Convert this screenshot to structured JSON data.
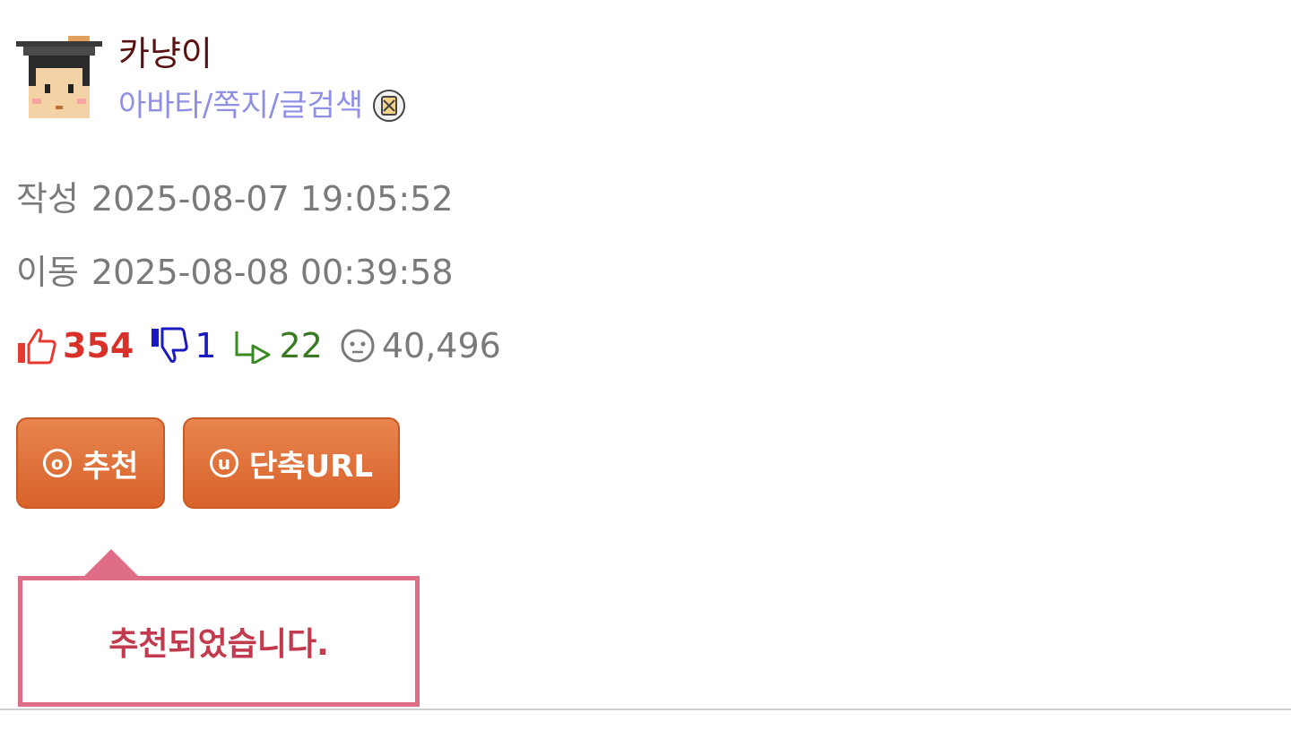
{
  "author": {
    "nickname": "카냥이",
    "links_label": "아바타/쪽지/글검색",
    "avatar_icon": "graduate-avatar-icon",
    "note_icon": "memo-icon"
  },
  "meta": {
    "written_label": "작성",
    "written_time": "2025-08-07 19:05:52",
    "moved_label": "이동",
    "moved_time": "2025-08-08 00:39:58"
  },
  "stats": {
    "upvotes": "354",
    "downvotes": "1",
    "replies": "22",
    "views": "40,496"
  },
  "buttons": {
    "recommend_icon_letter": "o",
    "recommend_label": "추천",
    "shorturl_icon_letter": "u",
    "shorturl_label": "단축URL"
  },
  "tooltip": {
    "message": "추천되었습니다."
  },
  "colors": {
    "upvote": "#d9302a",
    "downvote": "#1a1ac0",
    "reply": "#3a7a22",
    "button": "#d8622a",
    "tooltip_border": "#e06d87"
  }
}
